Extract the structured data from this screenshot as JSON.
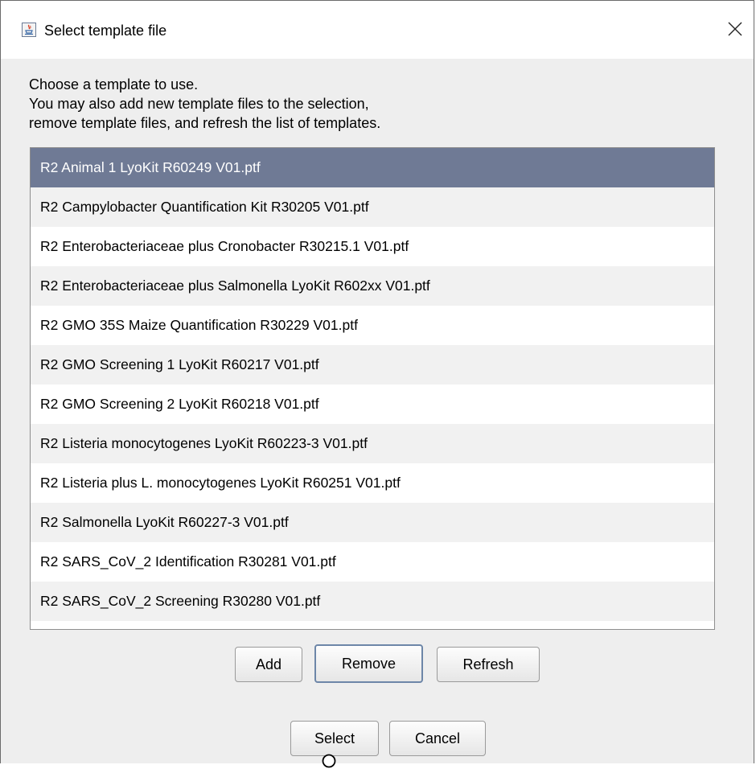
{
  "window": {
    "title": "Select template file"
  },
  "instructions": [
    "Choose a template to use.",
    "You may also add new template files to the selection,",
    "remove template files, and refresh the list of templates."
  ],
  "templates": [
    "R2 Animal 1 LyoKit R60249 V01.ptf",
    "R2 Campylobacter Quantification Kit R30205 V01.ptf",
    "R2 Enterobacteriaceae plus Cronobacter R30215.1 V01.ptf",
    "R2 Enterobacteriaceae plus Salmonella LyoKit R602xx V01.ptf",
    "R2 GMO 35S Maize Quantification R30229 V01.ptf",
    "R2 GMO Screening 1 LyoKit R60217 V01.ptf",
    "R2 GMO Screening 2 LyoKit R60218 V01.ptf",
    "R2 Listeria monocytogenes LyoKit R60223-3 V01.ptf",
    "R2 Listeria plus L. monocytogenes LyoKit R60251 V01.ptf",
    "R2 Salmonella LyoKit R60227-3 V01.ptf",
    "R2 SARS_CoV_2 Identification R30281 V01.ptf",
    "R2 SARS_CoV_2 Screening R30280 V01.ptf"
  ],
  "selected_template": "R2 Animal 1 LyoKit R60249 V01.ptf",
  "list_buttons": {
    "add": "Add",
    "remove": "Remove",
    "refresh": "Refresh"
  },
  "dialog_buttons": {
    "select": "Select",
    "cancel": "Cancel"
  },
  "colors": {
    "selection": "#6f7a95",
    "alt_row": "#f1f1f1",
    "dialog_bg": "#eeeeee"
  },
  "icons": {
    "app": "java-app-icon",
    "close": "close-icon"
  }
}
